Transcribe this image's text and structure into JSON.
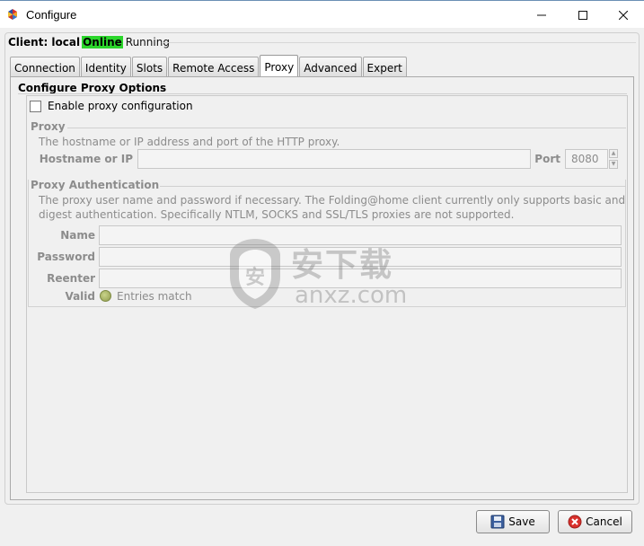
{
  "window": {
    "title": "Configure",
    "controls": {
      "minimize": "minimize-icon",
      "maximize": "maximize-icon",
      "close": "close-icon"
    }
  },
  "client": {
    "label": "Client: local",
    "status": "Online",
    "state": "Running",
    "status_color": "#2bd62b"
  },
  "tabs": [
    {
      "label": "Connection",
      "active": false
    },
    {
      "label": "Identity",
      "active": false
    },
    {
      "label": "Slots",
      "active": false
    },
    {
      "label": "Remote Access",
      "active": false
    },
    {
      "label": "Proxy",
      "active": true
    },
    {
      "label": "Advanced",
      "active": false
    },
    {
      "label": "Expert",
      "active": false
    }
  ],
  "proxy_panel": {
    "title": "Configure Proxy Options",
    "enable_checkbox": {
      "label": "Enable proxy configuration",
      "checked": false
    },
    "proxy_section": {
      "title": "Proxy",
      "help": "The hostname or IP address and port of the HTTP proxy.",
      "hostname_label": "Hostname or IP",
      "hostname_value": "",
      "port_label": "Port",
      "port_value": "8080"
    },
    "auth_section": {
      "title": "Proxy Authentication",
      "help_line1": "The proxy user name and password if necessary.  The Folding@home client currently only supports basic and",
      "help_line2": "digest authentication.  Specifically NTLM, SOCKS and SSL/TLS proxies are not supported.",
      "name_label": "Name",
      "name_value": "",
      "password_label": "Password",
      "password_value": "",
      "reenter_label": "Reenter",
      "reenter_value": "",
      "valid_label": "Valid",
      "valid_text": "Entries match"
    }
  },
  "watermark": {
    "cn_text": "安下载",
    "domain_text": "anxz.com"
  },
  "buttons": {
    "save": {
      "label": "Save",
      "icon": "floppy-disk-icon"
    },
    "cancel": {
      "label": "Cancel",
      "icon": "cancel-x-icon"
    }
  }
}
